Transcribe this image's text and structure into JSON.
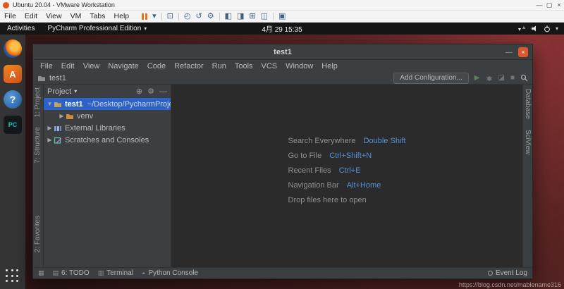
{
  "palette": {
    "selection_blue": "#2d63c8",
    "shortcut_key_blue": "#5692d8",
    "editor_bg": "#2b2b2b",
    "panel_bg": "#3c3f41",
    "desktop_red": "#5a2424",
    "ubuntu_orange": "#e0562c",
    "pause_orange": "#e8731a"
  },
  "vmware": {
    "window_title": "Ubuntu 20.04 - VMware Workstation",
    "menus": [
      "File",
      "Edit",
      "View",
      "VM",
      "Tabs",
      "Help"
    ],
    "toolbar_glyphs": {
      "dropdown": "▾",
      "ctrl_alt_del": "⊡",
      "snapshot": "◴",
      "revert": "↺",
      "settings": "⚙",
      "console_view": "◧",
      "unity_view": "◨",
      "grid_view": "⊞",
      "fullscreen": "◫",
      "library": "▣"
    },
    "window_controls": {
      "minimize": "—",
      "maximize": "▢",
      "close": "×"
    }
  },
  "topbar": {
    "activities_label": "Activities",
    "app_menu_label": "PyCharm Professional Edition",
    "caret": "▾",
    "clock": "4月 29 15:35"
  },
  "dock": {
    "software_glyph": "A",
    "help_glyph": "?",
    "pycharm_monogram": "PC"
  },
  "pycharm": {
    "title": "test1",
    "menus": [
      "File",
      "Edit",
      "View",
      "Navigate",
      "Code",
      "Refactor",
      "Run",
      "Tools",
      "VCS",
      "Window",
      "Help"
    ],
    "breadcrumb": "test1",
    "toolbar": {
      "add_configuration_label": "Add Configuration..."
    },
    "glyphs": {
      "caret": "▾",
      "play": "▶",
      "stop": "■",
      "coverage": "◪",
      "target": "⊕",
      "gear": "⚙",
      "hide": "—",
      "expand_open": "▼",
      "expand_closed": "▶",
      "switcher": "▦",
      "todo": "▤",
      "terminal": "▥",
      "python": "◓"
    },
    "left_strip": [
      "1: Project",
      "7: Structure",
      "2: Favorites"
    ],
    "right_strip": [
      "Database",
      "SciView"
    ],
    "project_panel": {
      "header_label": "Project",
      "tree": [
        {
          "name": "test1",
          "path": "~/Desktop/PycharmProjects/tes"
        },
        {
          "name": "venv",
          "path": ""
        },
        {
          "name": "External Libraries",
          "path": ""
        },
        {
          "name": "Scratches and Consoles",
          "path": ""
        }
      ]
    },
    "editor": {
      "shortcuts": [
        {
          "label": "Search Everywhere",
          "keys": "Double Shift"
        },
        {
          "label": "Go to File",
          "keys": "Ctrl+Shift+N"
        },
        {
          "label": "Recent Files",
          "keys": "Ctrl+E"
        },
        {
          "label": "Navigation Bar",
          "keys": "Alt+Home"
        },
        {
          "label": "Drop files here to open",
          "keys": ""
        }
      ]
    },
    "status_bar": {
      "todo_label": "6: TODO",
      "terminal_label": "Terminal",
      "python_console_label": "Python Console",
      "event_log_label": "Event Log"
    },
    "window_controls": {
      "minimize": "—",
      "close": "×"
    }
  },
  "watermark": "https://blog.csdn.net/mablename316"
}
